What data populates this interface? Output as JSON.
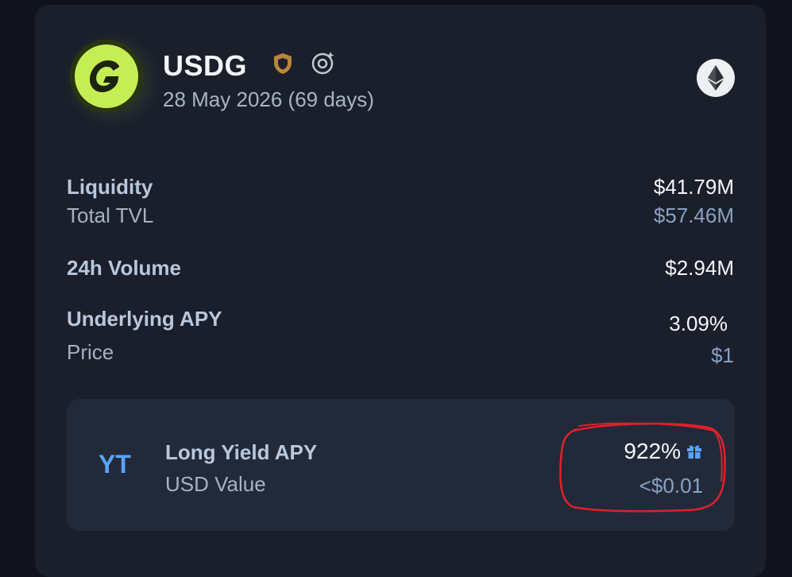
{
  "token": {
    "name": "USDG",
    "maturity": "28 May 2026 (69 days)",
    "icons": [
      "shield-icon",
      "reward-badge-icon",
      "ethereum-icon"
    ]
  },
  "stats": {
    "liquidity_label": "Liquidity",
    "liquidity_value": "$41.79M",
    "tvl_label": "Total TVL",
    "tvl_value": "$57.46M",
    "volume_label": "24h Volume",
    "volume_value": "$2.94M",
    "underlying_apy_label": "Underlying APY",
    "underlying_apy_value": "3.09%",
    "price_label": "Price",
    "price_value": "$1"
  },
  "yt": {
    "tag": "YT",
    "apy_label": "Long Yield APY",
    "apy_value": "922%",
    "usd_label": "USD Value",
    "usd_value": "<$0.01"
  },
  "colors": {
    "background": "#10131c",
    "card": "#1a1f2b",
    "yt_box": "#222a3a",
    "accent_blue": "#5aa3ff",
    "logo_green": "#c5ee55",
    "shield_gold": "#b9863a",
    "annotation_red": "#e0202a"
  }
}
